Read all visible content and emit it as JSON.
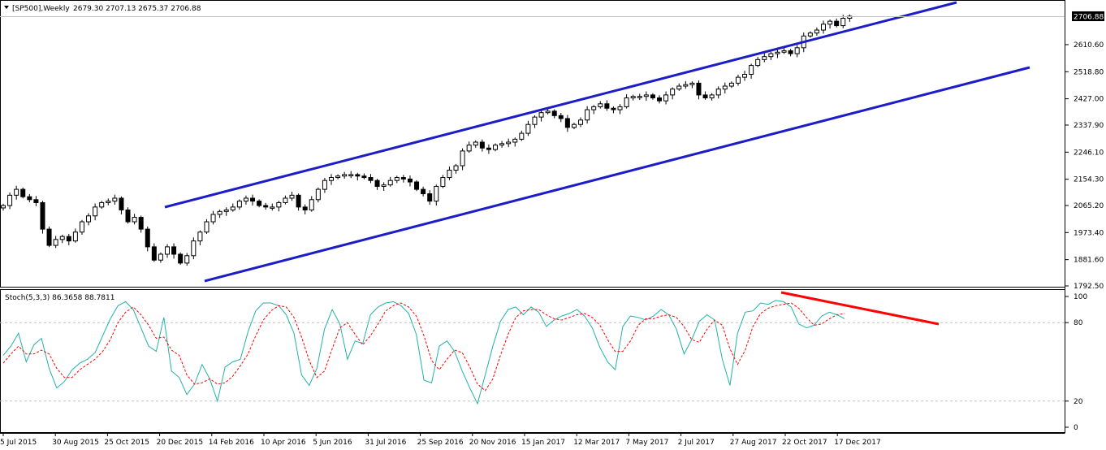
{
  "header": {
    "symbol": "[SP500],Weekly",
    "values": "2679.30 2707.13 2675.37 2706.88"
  },
  "indicator": {
    "label": "Stoch(5,3,3) 86.3658 88.7811"
  },
  "colors": {
    "background": "#ffffff",
    "grid": "#c0c0c0",
    "channel": "#0000cc",
    "divergence": "#ff0000",
    "main_line": "#20b2aa",
    "signal_line": "#ff0000",
    "current_price_bg": "#000000"
  },
  "chart_data": [
    {
      "type": "candlestick",
      "title": "[SP500],Weekly",
      "ylim": [
        1792.5,
        2720
      ],
      "y_ticks": [
        "2706.88",
        "2610.60",
        "2518.80",
        "2427.00",
        "2337.90",
        "2246.10",
        "2154.30",
        "2065.20",
        "1973.40",
        "1881.60",
        "1792.50"
      ],
      "current_price": "2706.88",
      "x_tick_labels": [
        "5 Jul 2015",
        "30 Aug 2015",
        "25 Oct 2015",
        "20 Dec 2015",
        "14 Feb 2016",
        "10 Apr 2016",
        "5 Jun 2016",
        "31 Jul 2016",
        "25 Sep 2016",
        "20 Nov 2016",
        "15 Jan 2017",
        "12 Mar 2017",
        "7 May 2017",
        "2 Jul 2017",
        "27 Aug 2017",
        "22 Oct 2017",
        "17 Dec 2017"
      ],
      "closes": [
        2065,
        2100,
        2120,
        2095,
        2085,
        2075,
        1985,
        1930,
        1950,
        1960,
        1945,
        1975,
        2010,
        2030,
        2060,
        2075,
        2080,
        2090,
        2050,
        2010,
        2025,
        1985,
        1925,
        1880,
        1900,
        1925,
        1900,
        1870,
        1895,
        1945,
        1975,
        2010,
        2035,
        2045,
        2050,
        2060,
        2080,
        2090,
        2080,
        2065,
        2060,
        2060,
        2075,
        2090,
        2100,
        2060,
        2050,
        2085,
        2120,
        2150,
        2160,
        2165,
        2170,
        2170,
        2165,
        2160,
        2150,
        2130,
        2135,
        2150,
        2160,
        2155,
        2145,
        2120,
        2105,
        2080,
        2130,
        2160,
        2185,
        2200,
        2250,
        2270,
        2280,
        2260,
        2255,
        2270,
        2275,
        2280,
        2290,
        2310,
        2340,
        2365,
        2380,
        2385,
        2370,
        2360,
        2330,
        2340,
        2355,
        2390,
        2400,
        2410,
        2395,
        2390,
        2400,
        2430,
        2435,
        2435,
        2440,
        2430,
        2420,
        2440,
        2460,
        2470,
        2475,
        2480,
        2440,
        2430,
        2440,
        2460,
        2470,
        2480,
        2500,
        2510,
        2540,
        2560,
        2570,
        2580,
        2585,
        2590,
        2580,
        2600,
        2640,
        2650,
        2660,
        2680,
        2690,
        2675,
        2700,
        2707
      ],
      "stoch_ylim": [
        0,
        100
      ],
      "stoch_levels": [
        20,
        80
      ],
      "stoch_ticks": [
        "100",
        "80",
        "20",
        "0"
      ],
      "series": [
        {
          "values": [
            55,
            62,
            72,
            50,
            63,
            68,
            45,
            30,
            35,
            44,
            49,
            52,
            57,
            70,
            83,
            93,
            96,
            90,
            76,
            62,
            58,
            84,
            43,
            38,
            25,
            33,
            48,
            37,
            20,
            46,
            50,
            52,
            73,
            89,
            95,
            95,
            93,
            86,
            72,
            40,
            32,
            45,
            75,
            90,
            79,
            52,
            66,
            64,
            86,
            92,
            95,
            96,
            93,
            87,
            71,
            36,
            34,
            62,
            66,
            58,
            43,
            30,
            18,
            40,
            62,
            81,
            90,
            92,
            86,
            92,
            88,
            77,
            82,
            85,
            87,
            90,
            85,
            76,
            61,
            50,
            44,
            77,
            85,
            84,
            82,
            85,
            90,
            86,
            75,
            56,
            67,
            81,
            86,
            82,
            52,
            32,
            72,
            88,
            89,
            95,
            94,
            97,
            96,
            92,
            79,
            76,
            78,
            85,
            88,
            86,
            83
          ]
        },
        {
          "values": [
            49,
            56,
            62,
            56,
            56,
            59,
            56,
            45,
            38,
            38,
            44,
            48,
            52,
            58,
            67,
            80,
            88,
            92,
            86,
            78,
            68,
            69,
            59,
            55,
            40,
            33,
            34,
            37,
            33,
            34,
            39,
            47,
            56,
            70,
            82,
            89,
            93,
            92,
            84,
            69,
            51,
            38,
            43,
            60,
            76,
            80,
            71,
            63,
            70,
            79,
            89,
            93,
            95,
            92,
            85,
            70,
            51,
            44,
            52,
            59,
            57,
            46,
            33,
            28,
            37,
            55,
            71,
            84,
            89,
            90,
            90,
            86,
            83,
            82,
            84,
            86,
            87,
            84,
            78,
            67,
            58,
            58,
            66,
            78,
            83,
            83,
            85,
            86,
            84,
            77,
            67,
            65,
            75,
            82,
            78,
            60,
            48,
            59,
            77,
            87,
            91,
            93,
            94,
            95,
            91,
            84,
            78,
            79,
            83,
            86,
            87
          ]
        }
      ]
    }
  ]
}
